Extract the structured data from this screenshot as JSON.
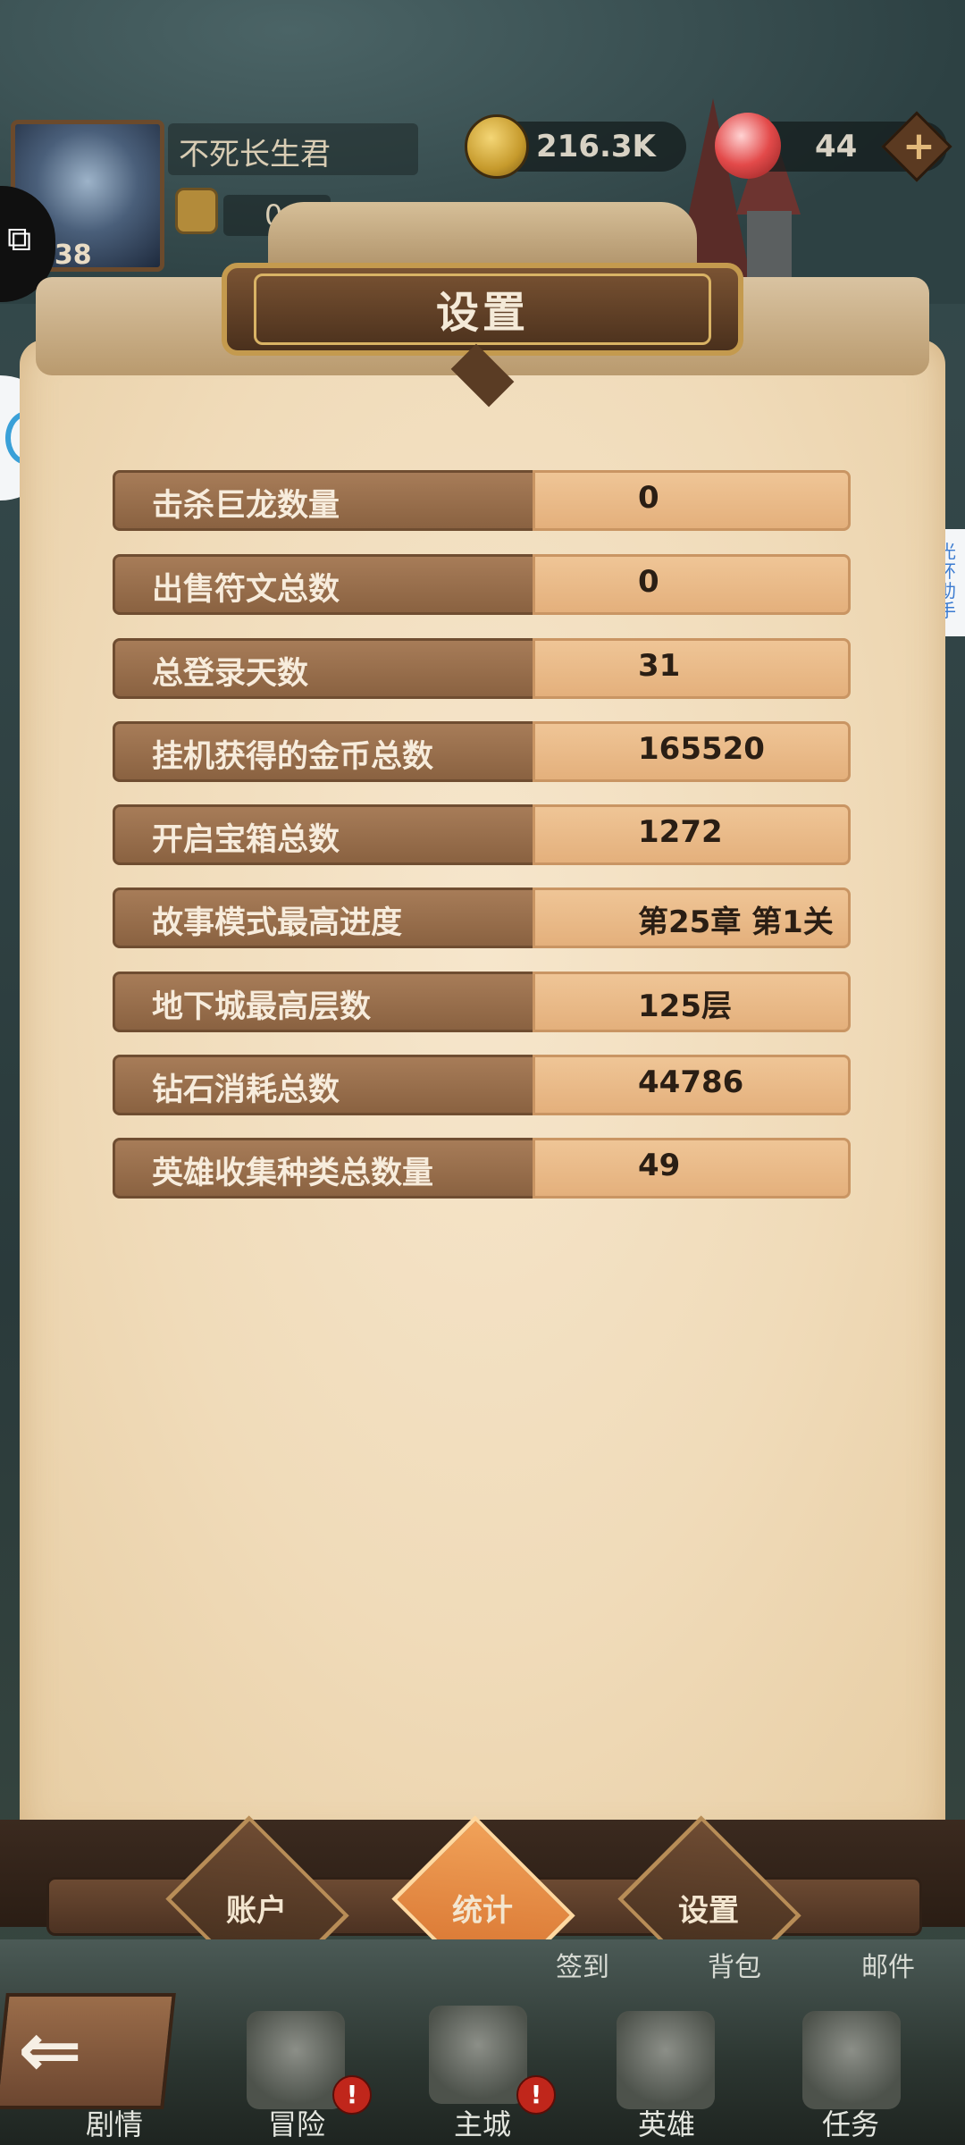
{
  "header": {
    "player_name": "不死长生君",
    "player_level": "138",
    "glove_count": "0",
    "gold": "216.3K",
    "gems": "44",
    "add_symbol": "+"
  },
  "side": {
    "right_tab_text": "光环助手"
  },
  "panel": {
    "title": "设置",
    "stats": [
      {
        "label": "击杀巨龙数量",
        "value": "0"
      },
      {
        "label": "出售符文总数",
        "value": "0"
      },
      {
        "label": "总登录天数",
        "value": "31"
      },
      {
        "label": "挂机获得的金币总数",
        "value": "165520"
      },
      {
        "label": "开启宝箱总数",
        "value": "1272"
      },
      {
        "label": "故事模式最高进度",
        "value": "第25章 第1关"
      },
      {
        "label": "地下城最高层数",
        "value": "125层"
      },
      {
        "label": "钻石消耗总数",
        "value": "44786"
      },
      {
        "label": "英雄收集种类总数量",
        "value": "49"
      }
    ]
  },
  "tabs": [
    {
      "label": "账户",
      "active": false
    },
    {
      "label": "统计",
      "active": true
    },
    {
      "label": "设置",
      "active": false
    }
  ],
  "sub_labels": [
    "签到",
    "背包",
    "邮件"
  ],
  "nav": [
    {
      "label": "剧情",
      "icon": "story-icon",
      "alert": false
    },
    {
      "label": "冒险",
      "icon": "crossed-swords-icon",
      "alert": true
    },
    {
      "label": "主城",
      "icon": "castle-icon",
      "alert": true
    },
    {
      "label": "英雄",
      "icon": "knight-helmet-icon",
      "alert": false
    },
    {
      "label": "任务",
      "icon": "scroll-icon",
      "alert": false
    }
  ],
  "alert_mark": "!",
  "colors": {
    "parchment": "#f0dbb9",
    "label_bg": "#8a6241",
    "value_bg": "#e4b07c",
    "active_tab": "#d46d2a",
    "alert": "#c0261b"
  }
}
